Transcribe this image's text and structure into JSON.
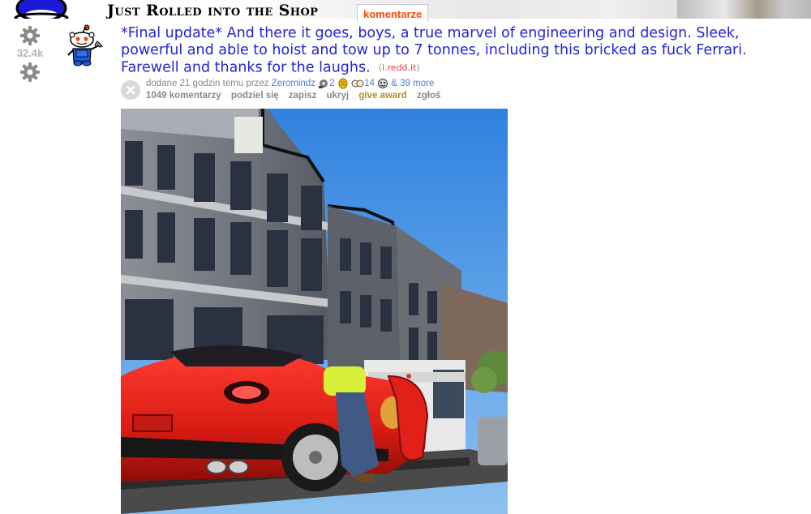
{
  "header": {
    "subreddit_title": "Just Rolled into the Shop",
    "comments_tab": "komentarze",
    "icons": [
      "snoo-logo-icon"
    ]
  },
  "vote": {
    "score": "32.4k",
    "upvote_icon": "gear-icon",
    "downvote_icon": "gear-icon"
  },
  "post": {
    "title": "*Final update* And there it goes, boys, a true marvel of engineering and design. Sleek, powerful and able to hoist and tow up to 7 tonnes, including this bricked as fuck Ferrari. Farewell and thanks for the laughs.",
    "domain": "i.redd.it",
    "tagline": {
      "prefix": "dodane 21 godzin temu przez",
      "author": "Zeromindz",
      "award_1_count": "2",
      "award_2_count": "14",
      "more": "& 39 more"
    },
    "buttons": {
      "comments": "1049 komentarzy",
      "share": "podziel się",
      "save": "zapisz",
      "hide": "ukryj",
      "give_award": "give award",
      "report": "zgłoś"
    }
  },
  "colors": {
    "title_link": "#2323d6",
    "comments_tab": "#ff4500",
    "author": "#4c7ae6",
    "give_award": "#b38d1a",
    "score": "#b4b4b4"
  }
}
